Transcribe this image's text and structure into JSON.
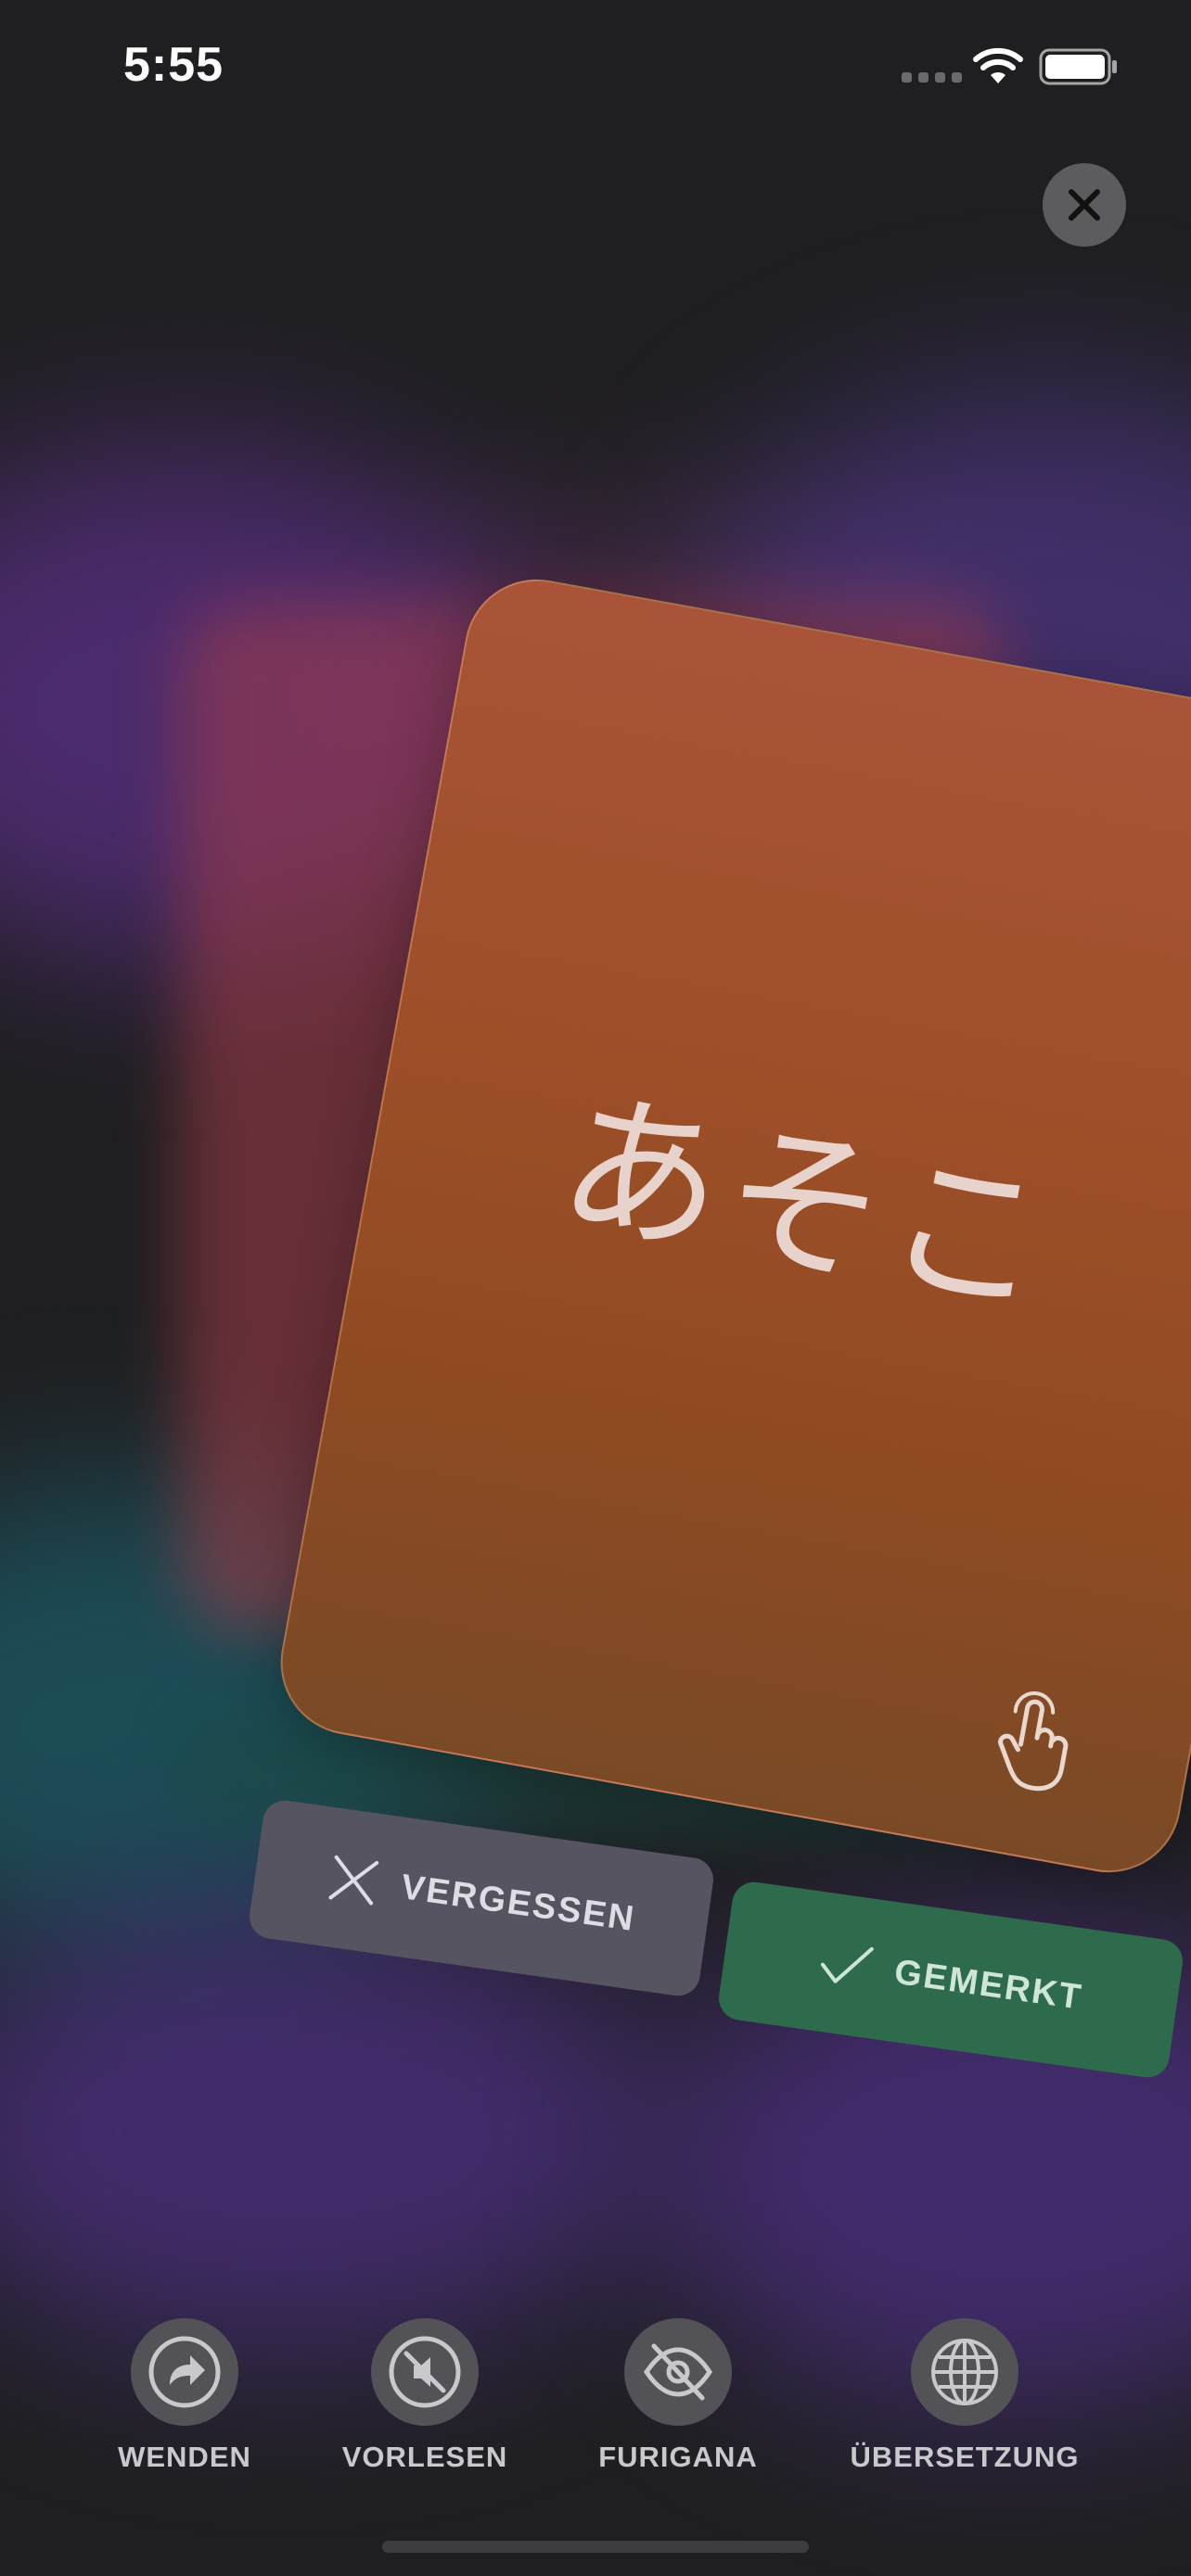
{
  "status_bar": {
    "time": "5:55"
  },
  "card": {
    "word": "あそこ"
  },
  "actions": {
    "forget_label": "VERGESSEN",
    "remember_label": "GEMERKT"
  },
  "toolbar": {
    "items": [
      {
        "label": "WENDEN",
        "icon": "flip-icon"
      },
      {
        "label": "VORLESEN",
        "icon": "speaker-muted-icon"
      },
      {
        "label": "FURIGANA",
        "icon": "eye-slash-icon"
      },
      {
        "label": "ÜBERSETZUNG",
        "icon": "globe-icon"
      }
    ]
  },
  "colors": {
    "card": "#9d4f28",
    "remember": "#2e6b4d",
    "forget": "#555460",
    "background": "#1f1f21"
  }
}
